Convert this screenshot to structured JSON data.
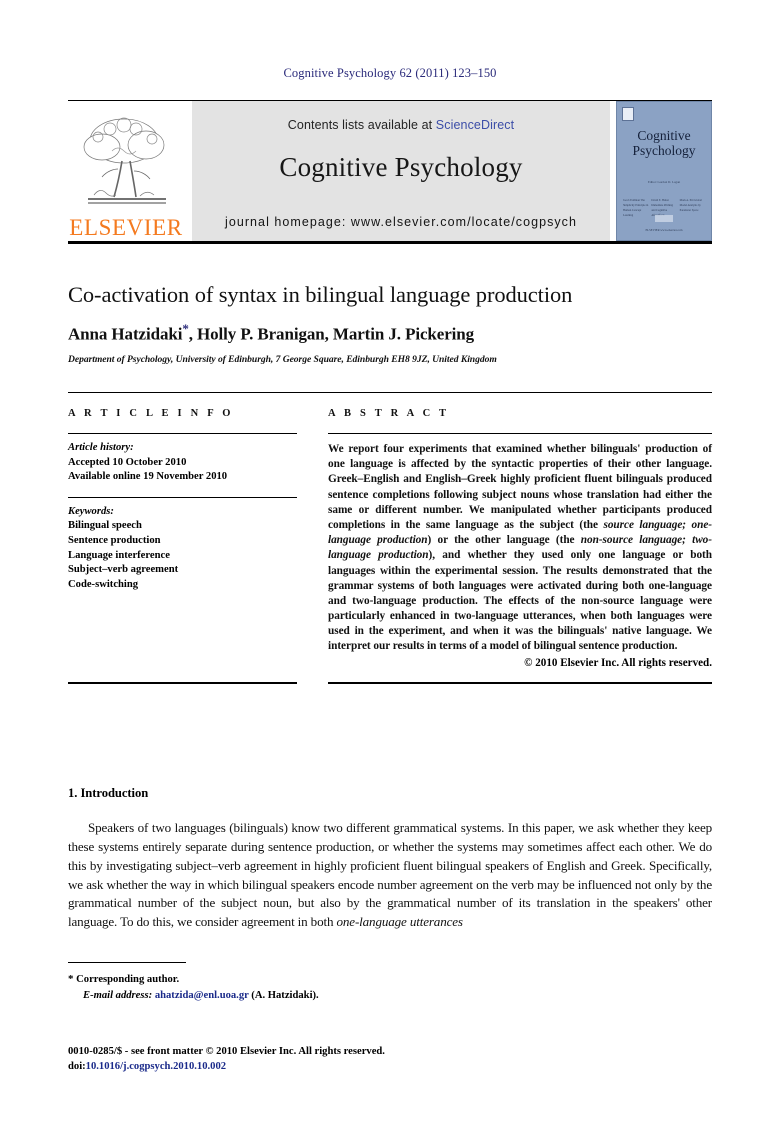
{
  "running_head": "Cognitive Psychology 62 (2011) 123–150",
  "header": {
    "publisher_name": "ELSEVIER",
    "contents_prefix": "Contents lists available at ",
    "sciencedirect": "ScienceDirect",
    "journal_name": "Cognitive Psychology",
    "homepage": "journal homepage: www.elsevier.com/locate/cogpsych",
    "cover": {
      "title_line1": "Cognitive",
      "title_line2": "Psychology",
      "subtext": "Editor: Gordon D. Logan",
      "col1": "Jacob Feldman\nThe Simplicity\nPrinciple in Human\nConcept Learning",
      "col2": "David E. Huber\nImmediate Priming\nand Cognitive\nAftereffects",
      "col3": "Mark A. Pitt\nGlobal Model\nAnalysis by\nParameter Space",
      "footer": "ELSEVIER\nwww.elsevier.com"
    },
    "colors": {
      "elsevier_orange": "#f47a1f",
      "sciencedirect_blue": "#3c4ea8",
      "band_grey": "#e3e3e3",
      "cover_blue": "#8ba2c4"
    }
  },
  "title_block": {
    "title": "Co-activation of syntax in bilingual language production",
    "authors": "Anna Hatzidaki",
    "authors_rest": ", Holly P. Branigan, Martin J. Pickering",
    "corresponding_mark": "*",
    "affiliation": "Department of Psychology, University of Edinburgh, 7 George Square, Edinburgh EH8 9JZ, United Kingdom"
  },
  "article_info": {
    "heading": "A R T I C L E   I N F O",
    "history_label": "Article history:",
    "history": [
      "Accepted 10 October 2010",
      "Available online 19 November 2010"
    ],
    "keywords_label": "Keywords:",
    "keywords": [
      "Bilingual speech",
      "Sentence production",
      "Language interference",
      "Subject–verb agreement",
      "Code-switching"
    ]
  },
  "abstract": {
    "heading": "A B S T R A C T",
    "p1": "We report four experiments that examined whether bilinguals' production of one language is affected by the syntactic properties of their other language. Greek–English and English–Greek highly proficient fluent bilinguals produced sentence completions following subject nouns whose translation had either the same or different number. We manipulated whether participants produced completions in the same language as the subject (the ",
    "i1": "source language; one-language production",
    "p2": ") or the other language (the ",
    "i2": "non-source language; two-language production",
    "p3": "), and whether they used only one language or both languages within the experimental session. The results demonstrated that the grammar systems of both languages were activated during both one-language and two-language production. The effects of the non-source language were particularly enhanced in two-language utterances, when both languages were used in the experiment, and when it was the bilinguals' native language. We interpret our results in terms of a model of bilingual sentence production.",
    "copyright": "© 2010 Elsevier Inc. All rights reserved."
  },
  "body": {
    "section_number_title": "1. Introduction",
    "p1_a": "Speakers of two languages (bilinguals) know two different grammatical systems. In this paper, we ask whether they keep these systems entirely separate during sentence production, or whether the systems may sometimes affect each other. We do this by investigating subject–verb agreement in highly proficient fluent bilingual speakers of English and Greek. Specifically, we ask whether the way in which bilingual speakers encode number agreement on the verb may be influenced not only by the grammatical number of the subject noun, but also by the grammatical number of its translation in the speakers' other language. To do this, we consider agreement in both ",
    "p1_i": "one-language utterances"
  },
  "footnotes": {
    "corresponding_mark": "*",
    "corresponding_label": "Corresponding author.",
    "email_label": "E-mail address:",
    "email": "ahatzida@enl.uoa.gr",
    "email_suffix": "(A. Hatzidaki)."
  },
  "imprint": {
    "line1": "0010-0285/$ - see front matter © 2010 Elsevier Inc. All rights reserved.",
    "doi_label": "doi:",
    "doi": "10.1016/j.cogpsych.2010.10.002"
  }
}
